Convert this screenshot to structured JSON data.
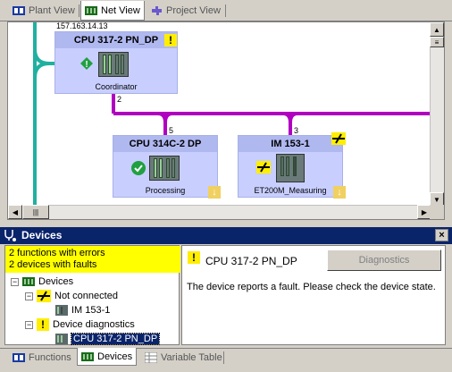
{
  "top_tabs": [
    {
      "label": "Plant View",
      "active": false
    },
    {
      "label": "Net View",
      "active": true
    },
    {
      "label": "Project View",
      "active": false
    }
  ],
  "netview": {
    "ip_address": "157.163.14.13",
    "devices": [
      {
        "title": "CPU 317-2 PN_DP",
        "name": "Coordinator",
        "status": "warning"
      },
      {
        "title": "CPU 314C-2 DP",
        "name": "Processing",
        "status": "ok"
      },
      {
        "title": "IM 153-1",
        "name": "ET200M_Measuring",
        "status": "not-connected"
      }
    ],
    "ports": [
      "2",
      "5",
      "3"
    ]
  },
  "devices_panel": {
    "title": "Devices",
    "summary_line1": "2 functions with errors",
    "summary_line2": "2 devices with faults",
    "tree": {
      "root": "Devices",
      "group1": "Not connected",
      "group1_child": "IM 153-1",
      "group2": "Device diagnostics",
      "group2_child": "CPU 317-2 PN_DP"
    },
    "detail_title": "CPU 317-2 PN_DP",
    "diagnostics_button": "Diagnostics",
    "message": "The device reports a fault. Please check the device state."
  },
  "bottom_tabs": [
    {
      "label": "Functions",
      "active": false
    },
    {
      "label": "Devices",
      "active": true
    },
    {
      "label": "Variable Table",
      "active": false
    }
  ],
  "colors": {
    "network_line_teal": "#20b0a0",
    "network_line_purple": "#b000c0",
    "device_bg": "#c8cfff",
    "title_bar": "#0a246a",
    "summary_bg": "#ffff00"
  }
}
